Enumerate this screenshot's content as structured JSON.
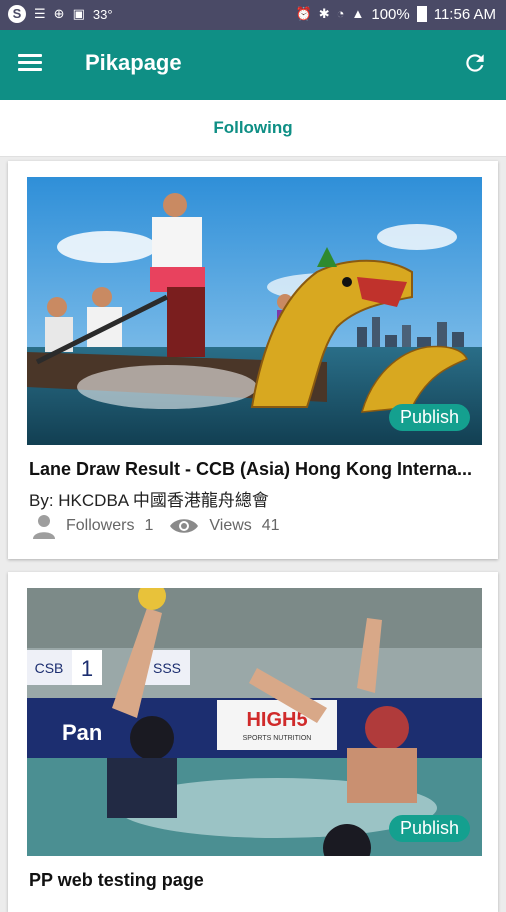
{
  "status_bar": {
    "left_icons": [
      "skype-icon",
      "notes-icon",
      "volte-icon",
      "image-icon"
    ],
    "left_extra": "33°",
    "battery": "100%",
    "time": "11:56 AM"
  },
  "app_bar": {
    "title": "Pikapage"
  },
  "tabs": {
    "active": "Following"
  },
  "cards": [
    {
      "title": "Lane Draw Result - CCB (Asia) Hong Kong Interna...",
      "author": "By: HKCDBA 中國香港龍舟總會",
      "followers_label": "Followers",
      "followers_count": "1",
      "views_label": "Views",
      "views_count": "41",
      "badge": "Publish"
    },
    {
      "title": "PP web testing page",
      "badge": "Publish",
      "image_texts": [
        "CSB",
        "1",
        "SSS",
        "Pan",
        "HIGH5",
        "SPORTS NUTRITION"
      ]
    }
  ],
  "colors": {
    "primary": "#0f8f85",
    "status_bar": "#4a4a66",
    "badge": "#14a08f"
  }
}
